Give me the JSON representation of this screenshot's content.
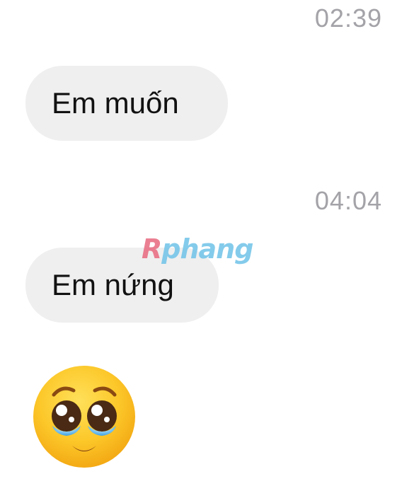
{
  "messages": [
    {
      "timestamp": "02:39",
      "text": "Em muốn"
    },
    {
      "timestamp": "04:04",
      "text": "Em nứng"
    }
  ],
  "emoji": {
    "name": "pleading-face-with-tears"
  },
  "watermark": {
    "first_letter": "R",
    "rest": "phang"
  },
  "colors": {
    "bubble_bg": "#efefef",
    "timestamp": "#a3a3a8",
    "text": "#111111"
  }
}
